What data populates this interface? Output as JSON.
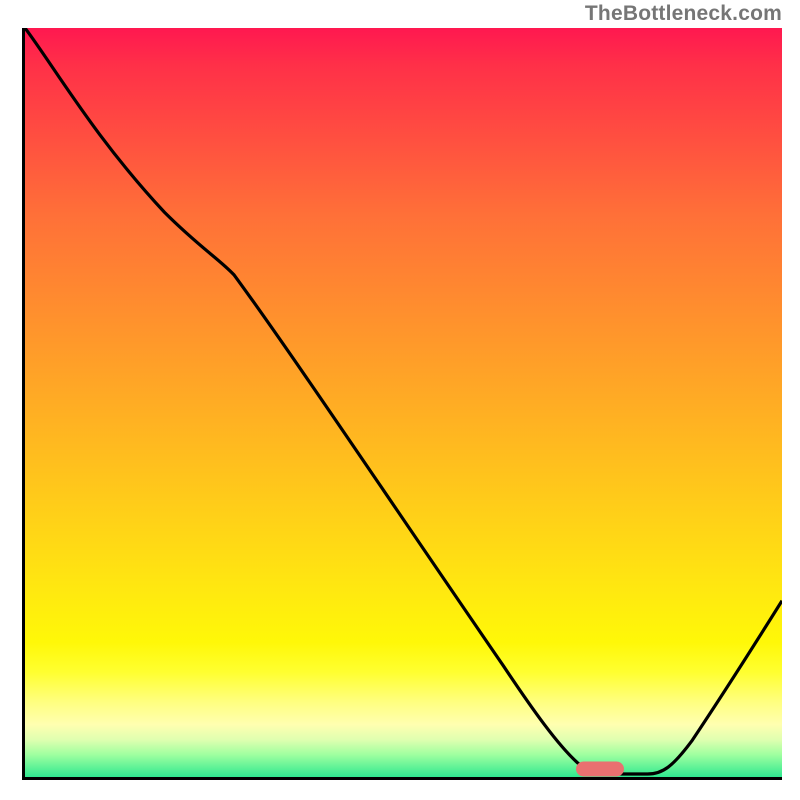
{
  "watermark": "TheBottleneck.com",
  "chart_data": {
    "type": "line",
    "title": "",
    "xlabel": "",
    "ylabel": "",
    "xlim": [
      0,
      100
    ],
    "ylim": [
      0,
      100
    ],
    "grid": false,
    "series": [
      {
        "name": "bottleneck-curve",
        "x": [
          0,
          8,
          20,
          26,
          40,
          55,
          68,
          73,
          78,
          82,
          100
        ],
        "y": [
          100,
          92,
          78,
          70,
          50,
          30,
          10,
          2,
          1,
          1,
          26
        ]
      }
    ],
    "marker": {
      "x": 76,
      "y": 1
    },
    "gradient": {
      "stops": [
        {
          "pos": 0,
          "color": "#ff1850"
        },
        {
          "pos": 50,
          "color": "#ffa828"
        },
        {
          "pos": 85,
          "color": "#ffff30"
        },
        {
          "pos": 100,
          "color": "#30e890"
        }
      ]
    }
  }
}
